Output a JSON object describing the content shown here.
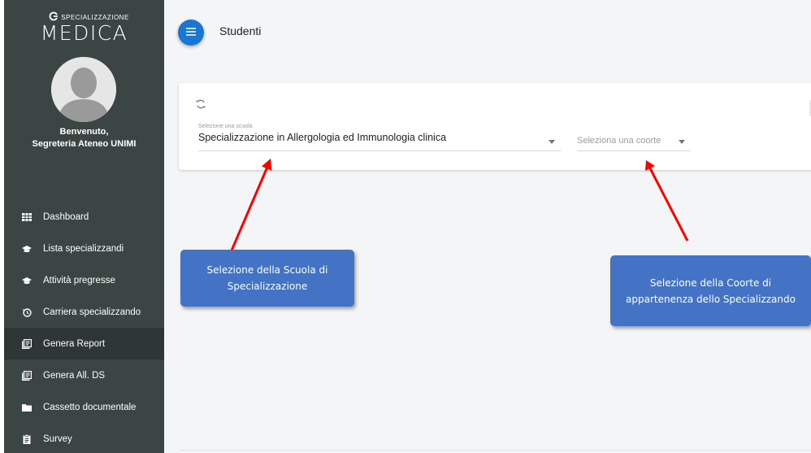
{
  "sidebar": {
    "logo_top": "SPECIALIZZAZIONE",
    "logo_main": "MEDICA",
    "welcome_line1": "Benvenuto,",
    "welcome_line2": "Segreteria Ateneo UNIMI",
    "items": [
      {
        "label": "Dashboard",
        "icon": "grid-icon"
      },
      {
        "label": "Lista specializzandi",
        "icon": "graduation-cap-icon"
      },
      {
        "label": "Attività pregresse",
        "icon": "graduation-cap-icon"
      },
      {
        "label": "Carriera specializzando",
        "icon": "history-icon"
      },
      {
        "label": "Genera Report",
        "icon": "report-icon",
        "active": true
      },
      {
        "label": "Genera All. DS",
        "icon": "report-icon"
      },
      {
        "label": "Cassetto documentale",
        "icon": "folder-icon"
      },
      {
        "label": "Survey",
        "icon": "clipboard-icon"
      }
    ]
  },
  "header": {
    "title": "Studenti"
  },
  "filters": {
    "school_label": "Selezione una scuola",
    "school_value": "Specializzazione in Allergologia ed Immunologia clinica",
    "cohort_placeholder": "Seleziona una coorte"
  },
  "annotations": {
    "callout1": "Selezione della Scuola di Specializzazione",
    "callout2": "Selezione della Coorte di appartenenza dello Specializzando",
    "arrow_color": "#ff0000"
  },
  "colors": {
    "sidebar_bg": "#3b4543",
    "accent": "#1976d2",
    "callout_bg": "#4472c4"
  }
}
